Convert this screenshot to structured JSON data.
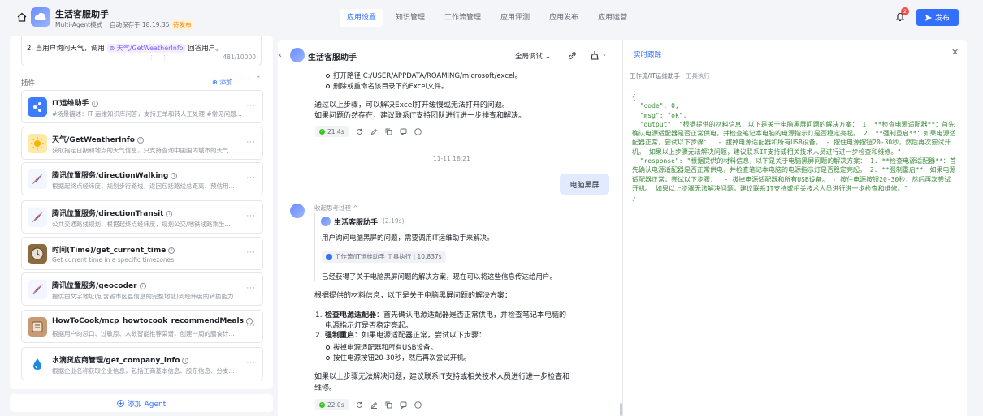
{
  "header": {
    "app_title": "生活客服助手",
    "mode": "Multi-Agent模式",
    "autosave": "自动保存于 18:19:35",
    "status_badge": "待发布",
    "nav": [
      "应用设置",
      "知识管理",
      "工作流管理",
      "应用评测",
      "应用发布",
      "应用运营"
    ],
    "active_nav": 0,
    "notification_count": "2",
    "publish_label": "发布"
  },
  "left": {
    "prompt": {
      "prefix": "2. 当用户询问天气，调用",
      "chip": "天气/GetWeatherInfo",
      "suffix": "回答用户。",
      "count": "481/10000"
    },
    "plugins_label": "插件",
    "add_label": "添加",
    "plugins": [
      {
        "name": "IT运维助手",
        "desc": "#场景描述：IT 运维知识库问答，支持工单和转人工处理 #常见问题...",
        "icon": "it-ops-icon"
      },
      {
        "name": "天气/GetWeatherInfo",
        "desc": "获取指定日期和地点的天气信息，只支持查询中国国内城市的天气",
        "icon": "weather-sun-icon"
      },
      {
        "name": "腾讯位置服务/directionWalking",
        "desc": "根据起终点经纬度，规划步行路线，返回包括路线总距离、预估用...",
        "icon": "map-compass-icon"
      },
      {
        "name": "腾讯位置服务/directionTransit",
        "desc": "公共交通路线规划，根据起终点经纬度，规划公交/地铁线路乘坐...",
        "icon": "map-compass-icon"
      },
      {
        "name": "时间(Time)/get_current_time",
        "desc": "Get current time in a specific timezones",
        "icon": "clock-icon"
      },
      {
        "name": "腾讯位置服务/geocoder",
        "desc": "提供由文字地址(包含省市区县信息的完整地址)到经纬度的转换能力...",
        "icon": "map-compass-icon"
      },
      {
        "name": "HowToCook/mcp_howtocook_recommendMeals",
        "desc": "根据用户的忌口、过敏原、人数智能推荐菜谱，创建一周的膳食计...",
        "icon": "cookbook-icon"
      },
      {
        "name": "水滴货应商管理/get_company_info",
        "desc": "根据企业名称获取企业信息，包括工商基本信息、股东信息、分支...",
        "icon": "water-drop-icon"
      }
    ],
    "add_agent_label": "添加 Agent"
  },
  "chat": {
    "title": "生活客服助手",
    "debug_mode": "全局调试",
    "prev_bullets": [
      "打开路径 C:/USER/APPDATA/ROAMING/microsoft/excel。",
      "删除或重命名该目录下的Excel文件。"
    ],
    "prev_para1": "通过以上步骤，可以解决Excel打开缓慢或无法打开的问题。",
    "prev_para2": "如果问题仍然存在，建议联系IT支持团队进行进一步排查和解决。",
    "prev_time": "21.4s",
    "divider_time": "11-11 18:21",
    "user_msg": "电脑黑屏",
    "thinking_label": "收起思考过程 ^",
    "think": {
      "agent": "生活客服助手",
      "duration": "(2.19s)",
      "line1": "用户询问电脑黑屏的问题，需要调用IT运维助手来解决。",
      "tool_chip": "工作流/IT运维助手  工具执行 | 10.837s",
      "line2": "已经获得了关于电脑黑屏问题的解决方案，现在可以将这些信息传达给用户。"
    },
    "answer_intro": "根据提供的材料信息，以下是关于电脑黑屏问题的解决方案：",
    "step1_title": "检查电源适配器",
    "step1_text": "：首先确认电源适配器是否正常供电，并检查笔记本电脑的",
    "step1_text2": "电源指示灯是否稳定亮起。",
    "step2_title": "强制重启",
    "step2_text": "：如果电源适配器正常，尝试以下步骤：",
    "step2_bullets": [
      "拔掉电源适配器和所有USB设备。",
      "按住电源按钮20-30秒，然后再次尝试开机。"
    ],
    "answer_outro1": "如果以上步骤无法解决问题，建议联系IT支持或相关技术人员进行进一步检查和",
    "answer_outro2": "维修。",
    "answer_time": "22.0s"
  },
  "trace": {
    "title": "实时跟踪",
    "tabs": [
      "工作流/IT运维助手",
      "工具执行"
    ],
    "json_text": "{\n  \"code\": 0,\n  \"msg\": \"ok\",\n  \"output\": \"根据提供的材料信息，以下是关于电脑黑屏问题的解决方案： 1. **检查电源适配器**：首先确认电源适配器是否正常供电，并检查笔记本电脑的电源指示灯是否稳定亮起。 2. **强制重启**：如果电源适配器正常，尝试以下步骤：  - 拔掉电源适配器和所有USB设备。 - 按住电源按钮20-30秒，然后再次尝试开机。 如果以上步骤无法解决问题，建议联系IT支持或相关技术人员进行进一步检查和维修。\",\n  \"response\": \"根据提供的材料信息，以下是关于电脑黑屏问题的解决方案： 1. **检查电源适配器**：首先确认电源适配器是否正常供电，并检查笔记本电脑的电源指示灯是否稳定亮起。 2. **强制重启**：如果电源适配器正常，尝试以下步骤：  - 拔掉电源适配器和所有USB设备。 - 按住电源按钮20-30秒，然后再次尝试开机。 如果以上步骤无法解决问题，建议联系IT支持或相关技术人员进行进一步检查和维修。\"\n}"
  }
}
